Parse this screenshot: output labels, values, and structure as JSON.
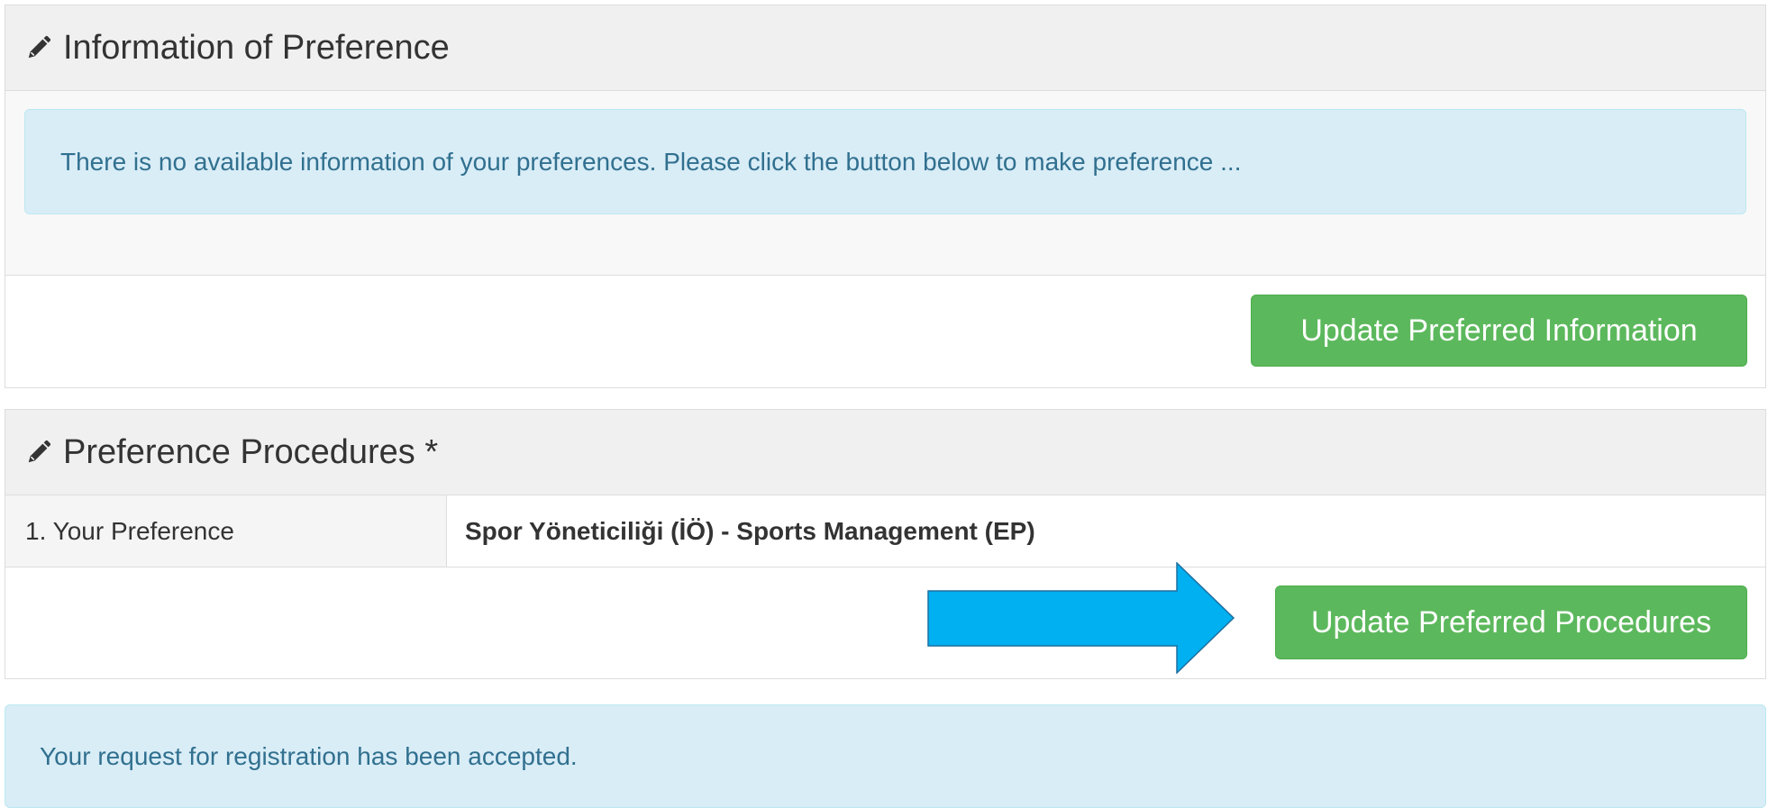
{
  "information_panel": {
    "title": "Information of Preference",
    "alert_text": "There is no available information of your preferences. Please click the button below to make preference ...",
    "button_label": "Update Preferred Information"
  },
  "procedures_panel": {
    "title": "Preference Procedures *",
    "rows": [
      {
        "label": "1. Your Preference",
        "value": "Spor Yöneticiliği (İÖ) - Sports Management (EP)"
      }
    ],
    "button_label": "Update Preferred Procedures"
  },
  "status_alert": {
    "text": "Your request for registration has been accepted."
  },
  "icons": {
    "panel_heading_icon": "pencil-icon",
    "annotation": "arrow-right-icon"
  },
  "colors": {
    "success_button": "#5cb85c",
    "info_alert_bg": "#d9edf7",
    "info_alert_text": "#31708f",
    "annotation_arrow": "#00b0f0",
    "panel_heading_bg": "#f0f0f0"
  }
}
